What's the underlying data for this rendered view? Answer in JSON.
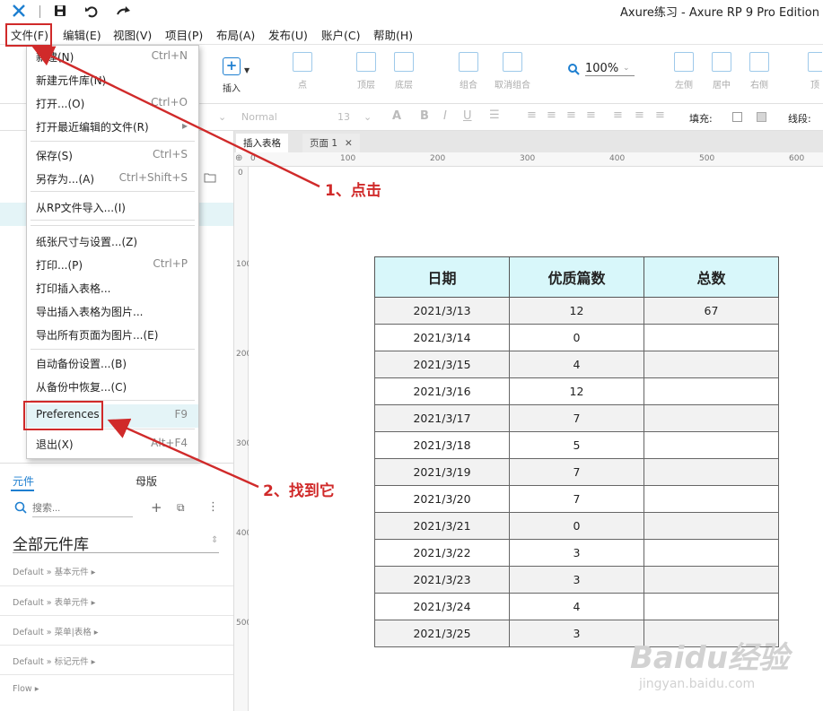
{
  "titlebar": {
    "title": "Axure练习 - Axure RP 9 Pro Edition"
  },
  "menubar": {
    "items": [
      "文件(F)",
      "编辑(E)",
      "视图(V)",
      "项目(P)",
      "布局(A)",
      "发布(U)",
      "账户(C)",
      "帮助(H)"
    ]
  },
  "toolbar": {
    "insert_label": "插入",
    "point_label": "点",
    "top_label": "顶层",
    "bottom_label": "底层",
    "group_label": "组合",
    "ungroup_label": "取消组合",
    "zoom": "100%",
    "left_label": "左侧",
    "center_label": "居中",
    "right_label": "右侧",
    "top2_label": "顶"
  },
  "formatbar": {
    "style": "Normal",
    "size": "13",
    "fill_label": "填充:",
    "line_label": "线段:"
  },
  "file_menu": {
    "items": [
      {
        "label": "新建(N)",
        "shortcut": "Ctrl+N"
      },
      {
        "label": "新建元件库(N)",
        "shortcut": ""
      },
      {
        "label": "打开...(O)",
        "shortcut": "Ctrl+O"
      },
      {
        "label": "打开最近编辑的文件(R)",
        "shortcut": "▸"
      },
      {
        "label": "保存(S)",
        "shortcut": "Ctrl+S"
      },
      {
        "label": "另存为...(A)",
        "shortcut": "Ctrl+Shift+S"
      },
      {
        "label": "从RP文件导入...(I)",
        "shortcut": ""
      },
      {
        "label": "纸张尺寸与设置...(Z)",
        "shortcut": ""
      },
      {
        "label": "打印...(P)",
        "shortcut": "Ctrl+P"
      },
      {
        "label": "打印插入表格...",
        "shortcut": ""
      },
      {
        "label": "导出插入表格为图片...",
        "shortcut": ""
      },
      {
        "label": "导出所有页面为图片...(E)",
        "shortcut": ""
      },
      {
        "label": "自动备份设置...(B)",
        "shortcut": ""
      },
      {
        "label": "从备份中恢复...(C)",
        "shortcut": ""
      },
      {
        "label": "Preferences",
        "shortcut": "F9"
      },
      {
        "label": "退出(X)",
        "shortcut": "Alt+F4"
      }
    ]
  },
  "page_tabs": [
    {
      "label": "插入表格"
    },
    {
      "label": "页面 1"
    }
  ],
  "ruler": {
    "h": [
      "0",
      "100",
      "200",
      "300",
      "400",
      "500",
      "600"
    ],
    "v": [
      "0",
      "100",
      "200",
      "300",
      "400",
      "500"
    ]
  },
  "left_panel": {
    "tab_widgets": "元件",
    "tab_masters": "母版",
    "search_placeholder": "搜索...",
    "library_title": "全部元件库",
    "libraries": [
      "Default » 基本元件 ▸",
      "Default » 表单元件 ▸",
      "Default » 菜单|表格 ▸",
      "Default » 标记元件 ▸",
      "Flow ▸"
    ]
  },
  "table": {
    "headers": [
      "日期",
      "优质篇数",
      "总数"
    ],
    "rows": [
      [
        "2021/3/13",
        "12",
        "67"
      ],
      [
        "2021/3/14",
        "0",
        ""
      ],
      [
        "2021/3/15",
        "4",
        ""
      ],
      [
        "2021/3/16",
        "12",
        ""
      ],
      [
        "2021/3/17",
        "7",
        ""
      ],
      [
        "2021/3/18",
        "5",
        ""
      ],
      [
        "2021/3/19",
        "7",
        ""
      ],
      [
        "2021/3/20",
        "7",
        ""
      ],
      [
        "2021/3/21",
        "0",
        ""
      ],
      [
        "2021/3/22",
        "3",
        ""
      ],
      [
        "2021/3/23",
        "3",
        ""
      ],
      [
        "2021/3/24",
        "4",
        ""
      ],
      [
        "2021/3/25",
        "3",
        ""
      ]
    ]
  },
  "annotations": {
    "step1": "1、点击",
    "step2": "2、找到它"
  },
  "watermark": {
    "brand": "Baidu经验",
    "url": "jingyan.baidu.com"
  },
  "colors": {
    "annotation_red": "#d02a2a",
    "table_header_bg": "#d8f7fa",
    "axure_blue": "#1e7fd0"
  }
}
